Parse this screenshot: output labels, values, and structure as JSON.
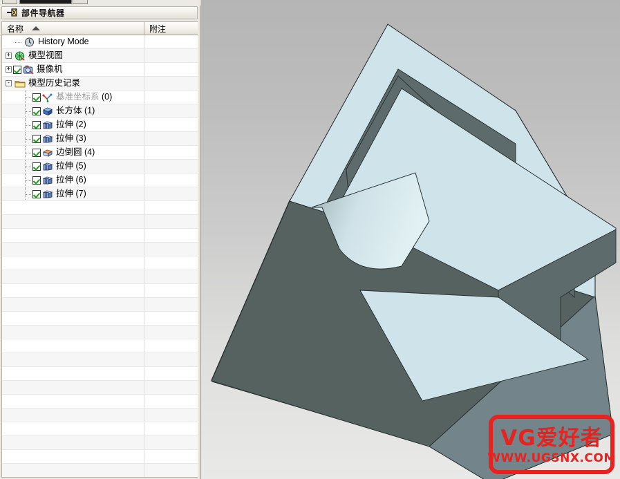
{
  "panel": {
    "title": "部件导航器",
    "pin_icon": "pin-icon",
    "columns": [
      {
        "key": "name",
        "label": "名称",
        "sort": "ascending",
        "sort_icon": "sort-ascending-triangle-icon"
      },
      {
        "key": "note",
        "label": "附注"
      }
    ],
    "rows": [
      {
        "indent": 1,
        "expander": null,
        "checkbox": null,
        "icon": "clock-history-icon",
        "label": "History Mode",
        "suffix": "",
        "dim": false
      },
      {
        "indent": 0,
        "expander": "+",
        "checkbox": null,
        "icon": "model-views-icon",
        "label": "模型视图",
        "suffix": "",
        "dim": false
      },
      {
        "indent": 0,
        "expander": "+",
        "checkbox": "checked",
        "icon": "camera-icon",
        "label": "摄像机",
        "suffix": "",
        "dim": false
      },
      {
        "indent": 0,
        "expander": "-",
        "checkbox": null,
        "icon": "folder-icon",
        "label": "模型历史记录",
        "suffix": "",
        "dim": false
      },
      {
        "indent": 2,
        "expander": null,
        "checkbox": "checked",
        "icon": "datum-csys-icon",
        "label": "基准坐标系",
        "suffix": " (0)",
        "dim": true
      },
      {
        "indent": 2,
        "expander": null,
        "checkbox": "checked",
        "icon": "block-icon",
        "label": "长方体",
        "suffix": " (1)",
        "dim": false
      },
      {
        "indent": 2,
        "expander": null,
        "checkbox": "checked",
        "icon": "extrude-icon",
        "label": "拉伸",
        "suffix": " (2)",
        "dim": false
      },
      {
        "indent": 2,
        "expander": null,
        "checkbox": "checked",
        "icon": "extrude-icon",
        "label": "拉伸",
        "suffix": " (3)",
        "dim": false
      },
      {
        "indent": 2,
        "expander": null,
        "checkbox": "checked",
        "icon": "edge-blend-icon",
        "label": "边倒圆",
        "suffix": " (4)",
        "dim": false
      },
      {
        "indent": 2,
        "expander": null,
        "checkbox": "checked",
        "icon": "extrude-icon",
        "label": "拉伸",
        "suffix": " (5)",
        "dim": false
      },
      {
        "indent": 2,
        "expander": null,
        "checkbox": "checked",
        "icon": "extrude-icon",
        "label": "拉伸",
        "suffix": " (6)",
        "dim": false
      },
      {
        "indent": 2,
        "expander": null,
        "checkbox": "checked",
        "icon": "extrude-icon",
        "label": "拉伸",
        "suffix": " (7)",
        "dim": false
      }
    ],
    "empty_row_count": 20
  },
  "viewport": {
    "name": "3d-model-viewport",
    "background_top": "#b5b5b5",
    "background_bottom": "#e9e9e8",
    "model_face_light": "#cfe4ea",
    "model_face_mid": "#7d8f92",
    "model_face_dark": "#566264",
    "edge_color": "#2b3334"
  },
  "watermark": {
    "name": "ugsnx-watermark",
    "line1": "VG爱好者",
    "line2": "WWW.UGSNX.COM",
    "color": "#e8231f"
  }
}
